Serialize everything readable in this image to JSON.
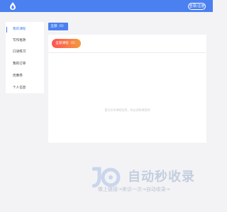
{
  "header": {
    "login_label": "登录/注册",
    "accent": "#4a80f0"
  },
  "sidebar": {
    "items": [
      {
        "label": "我的课程",
        "active": true
      },
      {
        "label": "写作批改",
        "active": false
      },
      {
        "label": "口语练习",
        "active": false
      },
      {
        "label": "我的订单",
        "active": false
      },
      {
        "label": "优惠券",
        "active": false
      },
      {
        "label": "个人信息",
        "active": false
      }
    ]
  },
  "main": {
    "top_tab_label": "全部（0）",
    "filter_pill_label": "全部课程（0）",
    "empty_text": "暂无任何课程信息，快去选购课程吧"
  },
  "watermark": {
    "title": "自动秒收录",
    "subtitle": "做上链接→来访一次→自动收录→"
  }
}
